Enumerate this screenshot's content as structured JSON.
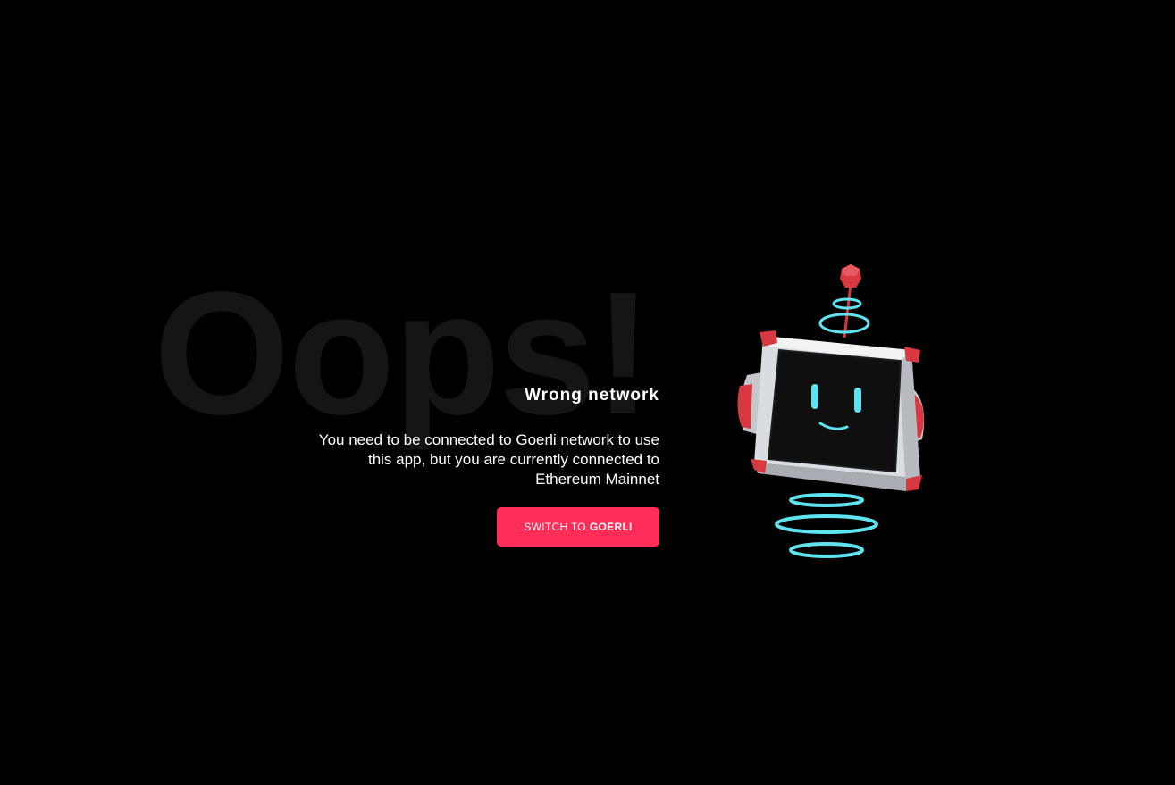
{
  "background_text": "Oops!",
  "error": {
    "title": "Wrong network",
    "message": "You need to be connected to Goerli network to use this app, but you are currently connected to Ethereum Mainnet"
  },
  "switch_button": {
    "prefix": "SWITCH TO",
    "network": "GOERLI"
  },
  "illustration": {
    "name": "robot-icon"
  },
  "colors": {
    "background": "#000000",
    "accent": "#ff2d58",
    "robot_glow": "#5fe3f0",
    "robot_red": "#d8383f"
  }
}
